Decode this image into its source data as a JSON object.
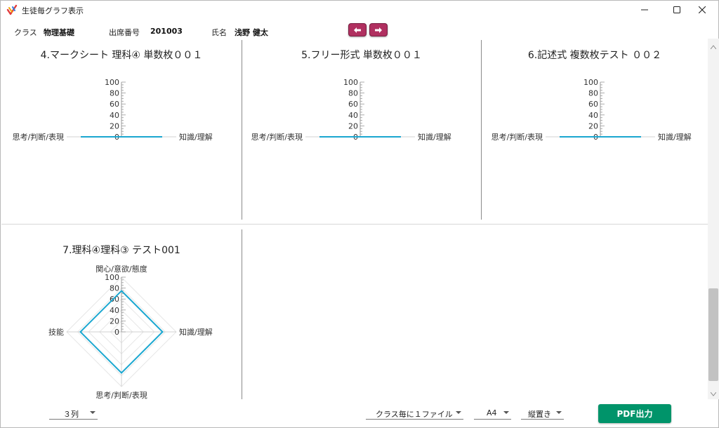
{
  "window": {
    "title": "生徒毎グラフ表示",
    "controls": {
      "minimize_icon": "minimize-icon",
      "maximize_icon": "maximize-icon",
      "close_icon": "close-icon"
    }
  },
  "header": {
    "class_label": "クラス",
    "class_value": "物理基礎",
    "attendance_label": "出席番号",
    "attendance_value": "201003",
    "name_label": "氏名",
    "name_value": "浅野 健太",
    "prev_icon": "arrow-left-icon",
    "next_icon": "arrow-right-icon",
    "nav_color": "#b03060"
  },
  "charts": [
    {
      "title": "4.マークシート 理科④ 単数枚００１",
      "type": "radar",
      "axes": [
        "知識/理解",
        "思考/判断/表現"
      ],
      "values": [
        0,
        0
      ],
      "ticks": [
        "100",
        "80",
        "60",
        "40",
        "20",
        "0"
      ]
    },
    {
      "title": "5.フリー形式 単数枚００１",
      "type": "radar",
      "axes": [
        "知識/理解",
        "思考/判断/表現"
      ],
      "values": [
        0,
        0
      ],
      "ticks": [
        "100",
        "80",
        "60",
        "40",
        "20",
        "0"
      ]
    },
    {
      "title": "6.記述式 複数枚テスト ００２",
      "type": "radar",
      "axes": [
        "知識/理解",
        "思考/判断/表現"
      ],
      "values": [
        0,
        0
      ],
      "ticks": [
        "100",
        "80",
        "60",
        "40",
        "20",
        "0"
      ]
    },
    {
      "title": "7.理科④理科③ テスト001",
      "type": "radar",
      "axes": [
        "関心/意欲/態度",
        "知識/理解",
        "思考/判断/表現",
        "技能"
      ],
      "values": [
        75,
        75,
        75,
        75
      ],
      "ticks": [
        "100",
        "80",
        "60",
        "40",
        "20",
        "0"
      ]
    }
  ],
  "chart_data": [
    {
      "type": "radar",
      "title": "4.マークシート 理科④ 単数枚００１",
      "axes": [
        "知識/理解",
        "思考/判断/表現"
      ],
      "values": [
        0,
        0
      ],
      "range": [
        0,
        100
      ],
      "series_color": "#1aa7d0"
    },
    {
      "type": "radar",
      "title": "5.フリー形式 単数枚００１",
      "axes": [
        "知識/理解",
        "思考/判断/表現"
      ],
      "values": [
        0,
        0
      ],
      "range": [
        0,
        100
      ],
      "series_color": "#1aa7d0"
    },
    {
      "type": "radar",
      "title": "6.記述式 複数枚テスト ００２",
      "axes": [
        "知識/理解",
        "思考/判断/表現"
      ],
      "values": [
        0,
        0
      ],
      "range": [
        0,
        100
      ],
      "series_color": "#1aa7d0"
    },
    {
      "type": "radar",
      "title": "7.理科④理科③ テスト001",
      "axes": [
        "関心/意欲/態度",
        "知識/理解",
        "思考/判断/表現",
        "技能"
      ],
      "values": [
        75,
        75,
        75,
        75
      ],
      "range": [
        0,
        100
      ],
      "series_color": "#1aa7d0"
    }
  ],
  "footer": {
    "columns_value": "３列",
    "file_mode_value": "クラス毎に１ファイル",
    "paper_size_value": "A4",
    "orientation_value": "縦置き",
    "pdf_button_label": "PDF出力",
    "pdf_color": "#00946a"
  }
}
